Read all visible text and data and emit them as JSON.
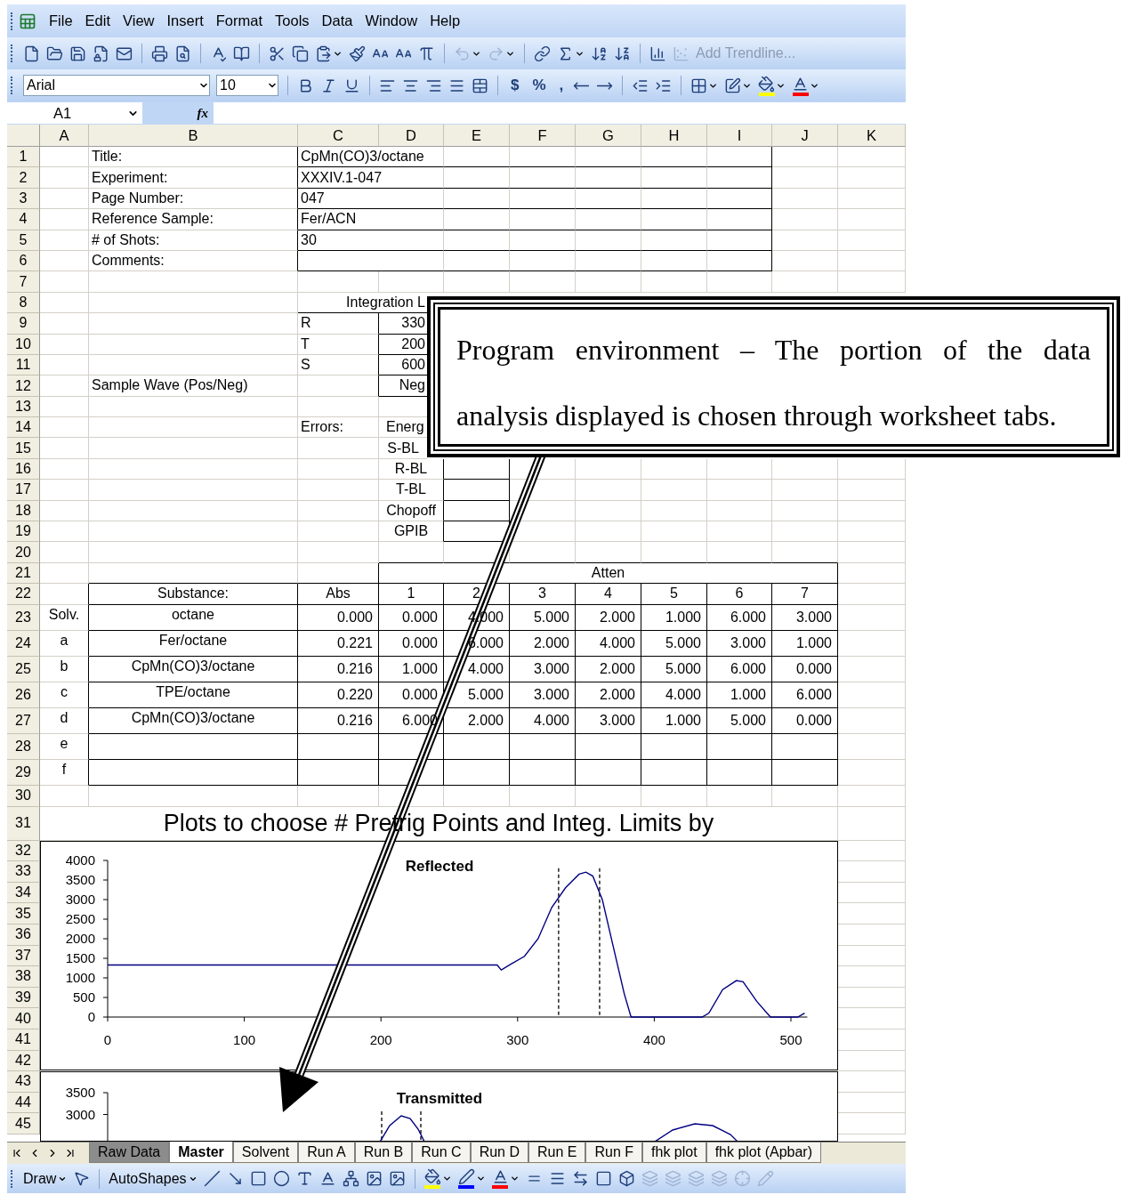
{
  "menu": [
    "File",
    "Edit",
    "View",
    "Insert",
    "Format",
    "Tools",
    "Data",
    "Window",
    "Help"
  ],
  "standard_toolbar": {
    "undo": {
      "disabled": true
    },
    "redo": {
      "disabled": true
    },
    "scatter": {
      "disabled": true
    },
    "trendline": {
      "label": "Add Trendline...",
      "disabled": true
    }
  },
  "format_toolbar": {
    "font": "Arial",
    "size": "10",
    "number_buttons": [
      "$",
      "%",
      ","
    ]
  },
  "formula_bar": {
    "name_box": "A1",
    "fx": "fx"
  },
  "columns": [
    "A",
    "B",
    "C",
    "D",
    "E",
    "F",
    "G",
    "H",
    "I",
    "J",
    "K"
  ],
  "rows": [
    {
      "number": "1",
      "kind": "info",
      "cells": {
        "B": "Title:",
        "C": "CpMn(CO)3/octane"
      }
    },
    {
      "number": "2",
      "kind": "info",
      "cells": {
        "B": "Experiment:",
        "C": "XXXIV.1-047"
      }
    },
    {
      "number": "3",
      "kind": "info",
      "cells": {
        "B": "Page Number:",
        "C": "047"
      }
    },
    {
      "number": "4",
      "kind": "info",
      "cells": {
        "B": "Reference Sample:",
        "C": "Fer/ACN"
      }
    },
    {
      "number": "5",
      "kind": "info",
      "cells": {
        "B": "# of Shots:",
        "C": "30"
      }
    },
    {
      "number": "6",
      "kind": "info",
      "cells": {
        "B": "Comments:"
      }
    },
    {
      "number": "7",
      "kind": "blank",
      "cells": {}
    },
    {
      "number": "8",
      "kind": "limit_header",
      "cells": {
        "D": "Integration L"
      }
    },
    {
      "number": "9",
      "kind": "limit",
      "cells": {
        "C": "R",
        "D": "330"
      }
    },
    {
      "number": "10",
      "kind": "limit",
      "cells": {
        "C": "T",
        "D": "200"
      }
    },
    {
      "number": "11",
      "kind": "limit",
      "cells": {
        "C": "S",
        "D": "600"
      }
    },
    {
      "number": "12",
      "kind": "limit",
      "cells": {
        "B": "Sample Wave (Pos/Neg)",
        "D": "Neg"
      }
    },
    {
      "number": "13",
      "kind": "blank",
      "cells": {}
    },
    {
      "number": "14",
      "kind": "errors",
      "cells": {
        "C": "Errors:",
        "D": "Energ"
      }
    },
    {
      "number": "15",
      "kind": "errors",
      "cells": {
        "D": "S-BL"
      }
    },
    {
      "number": "16",
      "kind": "errors",
      "cells": {
        "D": "R-BL"
      }
    },
    {
      "number": "17",
      "kind": "errors",
      "cells": {
        "D": "T-BL"
      }
    },
    {
      "number": "18",
      "kind": "errors",
      "cells": {
        "D": "Chopoff"
      }
    },
    {
      "number": "19",
      "kind": "errors",
      "cells": {
        "D": "GPIB"
      }
    },
    {
      "number": "20",
      "kind": "blank",
      "cells": {}
    },
    {
      "number": "21",
      "kind": "atten",
      "cells": {
        "D": "Atten"
      }
    },
    {
      "number": "22",
      "kind": "table_header",
      "cells": {
        "B": "Substance:",
        "C": "Abs",
        "D": "1",
        "E": "2",
        "F": "3",
        "G": "4",
        "H": "5",
        "I": "6",
        "J": "7"
      }
    },
    {
      "number": "23",
      "kind": "table",
      "cells": {
        "A": "Solv.",
        "B": "octane",
        "C": "0.000",
        "D": "0.000",
        "E": "4.000",
        "F": "5.000",
        "G": "2.000",
        "H": "1.000",
        "I": "6.000",
        "J": "3.000"
      }
    },
    {
      "number": "24",
      "kind": "table",
      "cells": {
        "A": "a",
        "B": "Fer/octane",
        "C": "0.221",
        "D": "0.000",
        "E": "6.000",
        "F": "2.000",
        "G": "4.000",
        "H": "5.000",
        "I": "3.000",
        "J": "1.000"
      }
    },
    {
      "number": "25",
      "kind": "table",
      "cells": {
        "A": "b",
        "B": "CpMn(CO)3/octane",
        "C": "0.216",
        "D": "1.000",
        "E": "4.000",
        "F": "3.000",
        "G": "2.000",
        "H": "5.000",
        "I": "6.000",
        "J": "0.000"
      }
    },
    {
      "number": "26",
      "kind": "table",
      "cells": {
        "A": "c",
        "B": "TPE/octane",
        "C": "0.220",
        "D": "0.000",
        "E": "5.000",
        "F": "3.000",
        "G": "2.000",
        "H": "4.000",
        "I": "1.000",
        "J": "6.000"
      }
    },
    {
      "number": "27",
      "kind": "table",
      "cells": {
        "A": "d",
        "B": "CpMn(CO)3/octane",
        "C": "0.216",
        "D": "6.000",
        "E": "2.000",
        "F": "4.000",
        "G": "3.000",
        "H": "1.000",
        "I": "5.000",
        "J": "0.000"
      }
    },
    {
      "number": "28",
      "kind": "table",
      "cells": {
        "A": "e"
      }
    },
    {
      "number": "29",
      "kind": "table",
      "cells": {
        "A": "f"
      }
    },
    {
      "number": "30",
      "kind": "blank",
      "cells": {}
    },
    {
      "number": "31",
      "kind": "title",
      "cells": {
        "A": "Plots to choose # Pretrig Points and Integ. Limits by"
      }
    },
    {
      "number": "32",
      "kind": "chart",
      "cells": {}
    },
    {
      "number": "33",
      "kind": "chart",
      "cells": {}
    },
    {
      "number": "34",
      "kind": "chart",
      "cells": {}
    },
    {
      "number": "35",
      "kind": "chart",
      "cells": {}
    },
    {
      "number": "36",
      "kind": "chart",
      "cells": {}
    },
    {
      "number": "37",
      "kind": "chart",
      "cells": {}
    },
    {
      "number": "38",
      "kind": "chart",
      "cells": {}
    },
    {
      "number": "39",
      "kind": "chart",
      "cells": {}
    },
    {
      "number": "40",
      "kind": "chart",
      "cells": {}
    },
    {
      "number": "41",
      "kind": "chart",
      "cells": {}
    },
    {
      "number": "42",
      "kind": "chart",
      "cells": {}
    },
    {
      "number": "43",
      "kind": "chart",
      "cells": {}
    },
    {
      "number": "44",
      "kind": "chart",
      "cells": {}
    },
    {
      "number": "45",
      "kind": "chart",
      "cells": {}
    }
  ],
  "charts": [
    {
      "chart_data": {
        "type": "line",
        "title": "Reflected",
        "x": [
          0,
          280,
          285,
          288,
          295,
          305,
          315,
          325,
          335,
          345,
          350,
          355,
          362,
          370,
          378,
          383,
          385,
          435,
          440,
          450,
          460,
          465,
          475,
          485,
          490,
          505,
          510
        ],
        "series": [
          {
            "color": "#000080",
            "values": [
              1330,
              1330,
              1330,
              1200,
              1350,
              1550,
              2000,
              2800,
              3300,
              3650,
              3700,
              3600,
              3000,
              1800,
              600,
              0,
              0,
              0,
              100,
              700,
              930,
              900,
              400,
              0,
              0,
              0,
              100
            ]
          }
        ],
        "xlim": [
          0,
          512
        ],
        "ylim": [
          0,
          4000
        ],
        "xticks": [
          {
            "value": 0,
            "label": "0"
          },
          {
            "value": 100,
            "label": "100"
          },
          {
            "value": 200,
            "label": "200"
          },
          {
            "value": 300,
            "label": "300"
          },
          {
            "value": 400,
            "label": "400"
          },
          {
            "value": 500,
            "label": "500"
          }
        ],
        "yticks": [
          {
            "value": 0,
            "label": "0"
          },
          {
            "value": 500,
            "label": "500"
          },
          {
            "value": 1000,
            "label": "1000"
          },
          {
            "value": 1500,
            "label": "1500"
          },
          {
            "value": 2000,
            "label": "2000"
          },
          {
            "value": 2500,
            "label": "2500"
          },
          {
            "value": 3000,
            "label": "3000"
          },
          {
            "value": 3500,
            "label": "3500"
          },
          {
            "value": 4000,
            "label": "4000"
          }
        ],
        "ref_lines": [
          {
            "axis": "x",
            "value": 330
          },
          {
            "axis": "x",
            "value": 360
          }
        ]
      }
    },
    {
      "title": "Transmitted",
      "axis_labels": [
        "3500",
        "3000"
      ]
    }
  ],
  "sheet_tabs": [
    {
      "label": "Raw Data",
      "selected": false,
      "color": "#8c8c8c"
    },
    {
      "label": "Master",
      "selected": true,
      "color": "#ffffff"
    },
    {
      "label": "Solvent",
      "selected": false,
      "color": "#f5f4ee"
    },
    {
      "label": "Run A",
      "selected": false,
      "color": "#f5f4ee"
    },
    {
      "label": "Run B",
      "selected": false,
      "color": "#f5f4ee"
    },
    {
      "label": "Run C",
      "selected": false,
      "color": "#f5f4ee"
    },
    {
      "label": "Run D",
      "selected": false,
      "color": "#f5f4ee"
    },
    {
      "label": "Run E",
      "selected": false,
      "color": "#f5f4ee"
    },
    {
      "label": "Run F",
      "selected": false,
      "color": "#f5f4ee"
    },
    {
      "label": "fhk plot",
      "selected": false,
      "color": "#f5f4ee"
    },
    {
      "label": "fhk plot (Apbar)",
      "selected": false,
      "color": "#f5f4ee"
    }
  ],
  "drawing_toolbar": {
    "draw_label": "Draw",
    "autoshapes_label": "AutoShapes",
    "arrange_tools": {
      "disabled": true
    }
  },
  "callout": {
    "text": "Program environment – The portion of the data analysis displayed is chosen through worksheet tabs."
  }
}
